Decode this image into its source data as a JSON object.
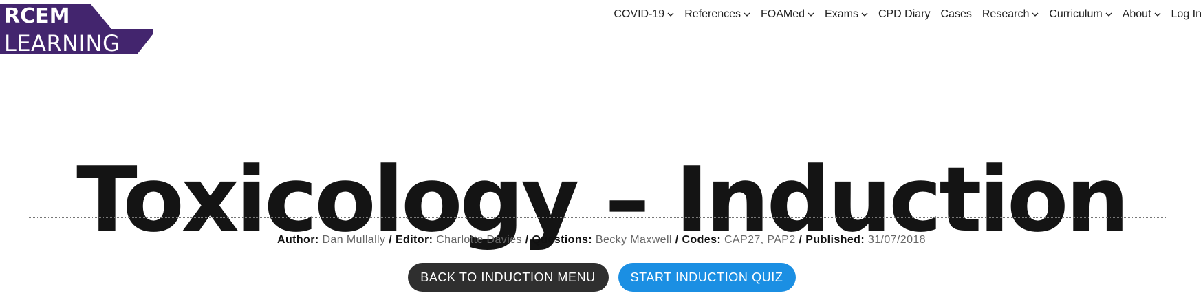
{
  "logo": {
    "line1": "RCEM",
    "line2": "LEARNING",
    "color": "#43256e"
  },
  "nav": {
    "items": [
      {
        "label": "COVID-19",
        "dropdown": true
      },
      {
        "label": "References",
        "dropdown": true
      },
      {
        "label": "FOAMed",
        "dropdown": true
      },
      {
        "label": "Exams",
        "dropdown": true
      },
      {
        "label": "CPD Diary",
        "dropdown": false
      },
      {
        "label": "Cases",
        "dropdown": false
      },
      {
        "label": "Research",
        "dropdown": true
      },
      {
        "label": "Curriculum",
        "dropdown": true
      },
      {
        "label": "About",
        "dropdown": true
      },
      {
        "label": "Log In",
        "dropdown": false
      }
    ]
  },
  "page": {
    "title": "Toxicology – Induction"
  },
  "meta": {
    "author_label": "Author:",
    "author": "Dan Mullally",
    "editor_label": "Editor:",
    "editor": "Charlotte Davies",
    "questions_label": "Questions:",
    "questions": "Becky Maxwell",
    "codes_label": "Codes:",
    "codes": "CAP27, PAP2",
    "published_label": "Published:",
    "published": "31/07/2018",
    "separator": "/"
  },
  "actions": {
    "back_label": "BACK TO INDUCTION MENU",
    "start_label": "START INDUCTION QUIZ"
  },
  "colors": {
    "brand_purple": "#43256e",
    "button_dark": "#2f2f2f",
    "button_blue": "#1b8fe3"
  }
}
